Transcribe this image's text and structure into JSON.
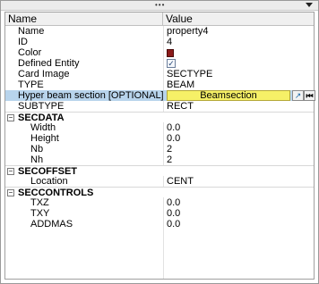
{
  "header": {
    "name_label": "Name",
    "value_label": "Value"
  },
  "props": [
    {
      "name": "Name",
      "value": "property4"
    },
    {
      "name": "ID",
      "value": "4"
    },
    {
      "name": "Color",
      "color": "#8b1a1a"
    },
    {
      "name": "Defined Entity",
      "checked": true,
      "check_glyph": "✓"
    },
    {
      "name": "Card Image",
      "value": "SECTYPE"
    },
    {
      "name": "TYPE",
      "value": "BEAM"
    },
    {
      "name": "Hyper beam section [OPTIONAL]",
      "button": "Beamsection"
    },
    {
      "name": "SUBTYPE",
      "value": "RECT"
    }
  ],
  "sections": [
    {
      "title": "SECDATA",
      "toggle": "−",
      "rows": [
        {
          "name": "Width",
          "value": "0.0"
        },
        {
          "name": "Height",
          "value": "0.0"
        },
        {
          "name": "Nb",
          "value": "2"
        },
        {
          "name": "Nh",
          "value": "2"
        }
      ]
    },
    {
      "title": "SECOFFSET",
      "toggle": "−",
      "rows": [
        {
          "name": "Location",
          "value": "CENT"
        }
      ]
    },
    {
      "title": "SECCONTROLS",
      "toggle": "−",
      "rows": [
        {
          "name": "TXZ",
          "value": "0.0"
        },
        {
          "name": "TXY",
          "value": "0.0"
        },
        {
          "name": "ADDMAS",
          "value": "0.0"
        }
      ]
    }
  ],
  "icons": {
    "grip": "drag-grip-icon",
    "menu": "dropdown-arrow-icon",
    "pick": "pick-arrow-icon",
    "reset": "skip-first-icon"
  },
  "glyphs": {
    "grip": "•••",
    "pick": "↗",
    "reset": "⏮"
  }
}
